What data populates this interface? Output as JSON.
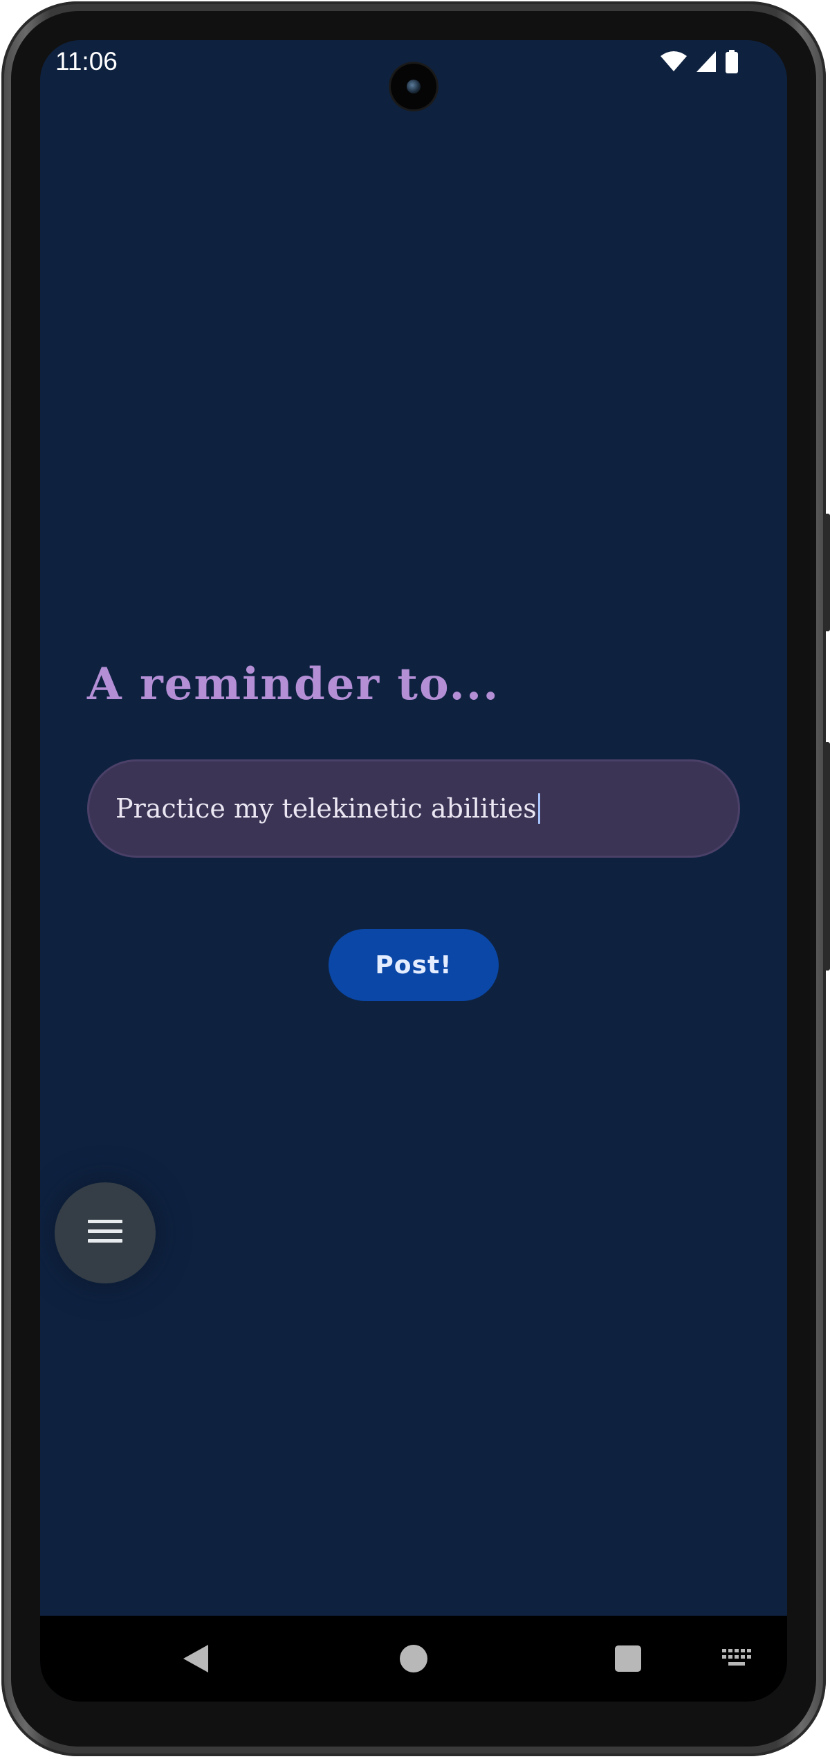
{
  "status_bar": {
    "time": "11:06",
    "icons": [
      "wifi-icon",
      "cellular-signal-icon",
      "battery-icon"
    ]
  },
  "main": {
    "heading": "A reminder to...",
    "reminder_input": {
      "value": "Practice my telekinetic abilities",
      "placeholder": ""
    },
    "post_button_label": "Post!"
  },
  "fab": {
    "icon": "menu-icon"
  },
  "nav_bar": {
    "icons": [
      "back-icon",
      "home-icon",
      "recents-icon",
      "keyboard-icon"
    ]
  },
  "colors": {
    "background": "#0e2240",
    "heading": "#b48fd6",
    "input_background": "#3b3455",
    "post_button": "#0b47a6",
    "fab_background": "#353e46"
  }
}
